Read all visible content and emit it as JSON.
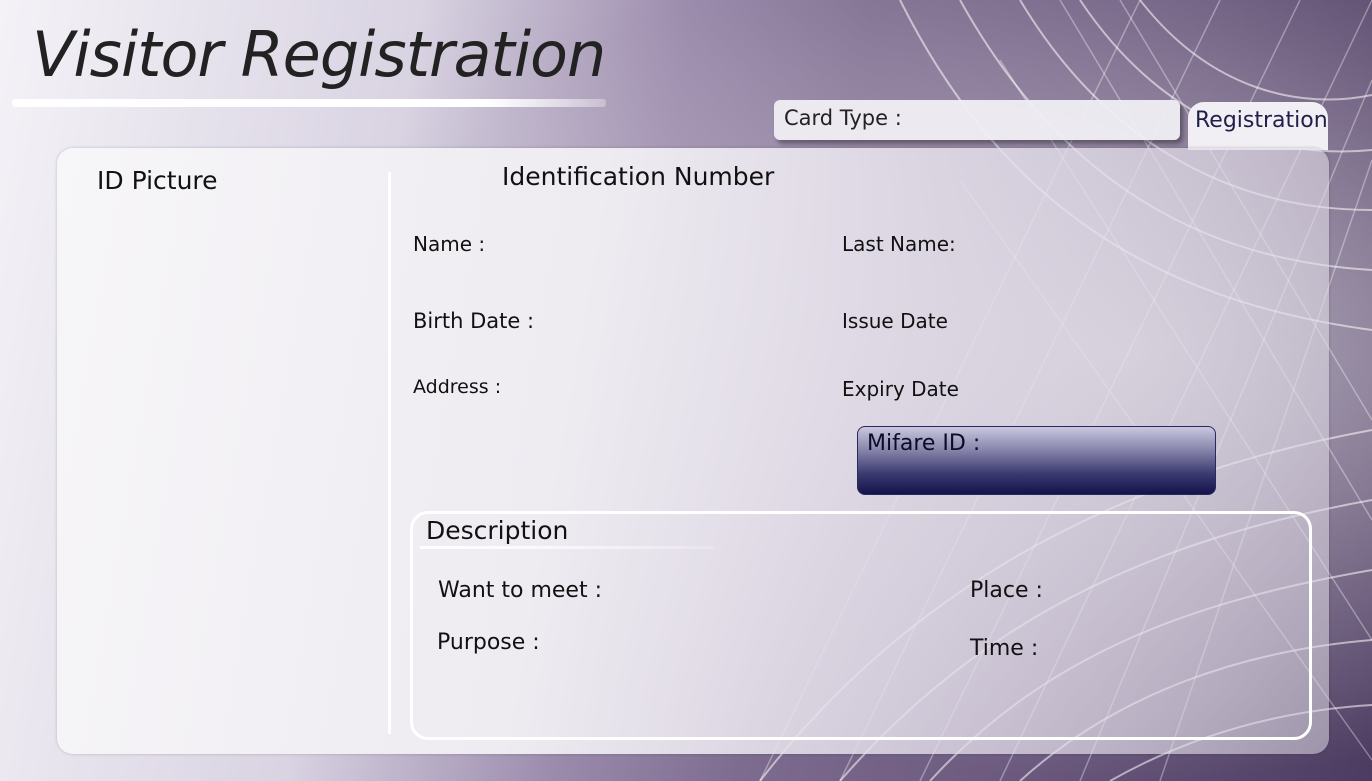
{
  "header": {
    "title": "Visitor Registration"
  },
  "card_type": {
    "label": "Card Type  :"
  },
  "tabs": [
    {
      "label": "Registration"
    }
  ],
  "panel": {
    "id_picture_label": "ID Picture",
    "identification_number_label": "Identification Number",
    "fields": {
      "name": "Name  :",
      "last_name": "Last Name:",
      "birth_date": "Birth Date  :",
      "issue_date": "Issue Date",
      "address": "Address  :",
      "expiry_date": "Expiry Date"
    },
    "mifare_id": "Mifare ID :"
  },
  "description": {
    "title": "Description",
    "want_to_meet": "Want to meet :",
    "place": "Place :",
    "purpose": "Purpose :",
    "time": "Time  :"
  },
  "colors": {
    "accent_dark": "#14134a",
    "panel_bg": "#eeebf1",
    "background_purple": "#6c5a7f"
  }
}
